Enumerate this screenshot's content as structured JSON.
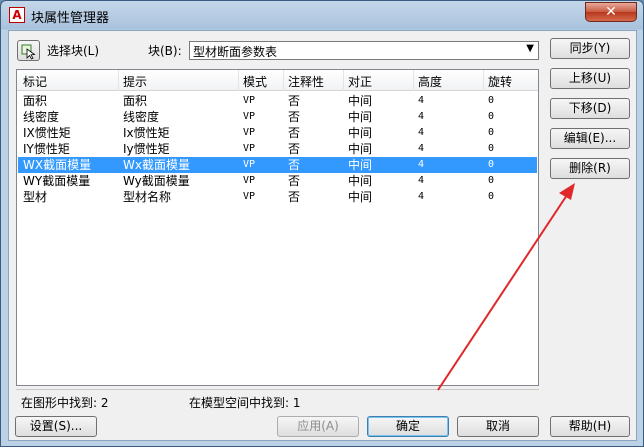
{
  "window": {
    "title": "块属性管理器",
    "app_icon": "A",
    "close_glyph": "✕"
  },
  "toolbar": {
    "select_block_label": "选择块(L)",
    "block_label": "块(B):",
    "block_value": "型材断面参数表",
    "block_arrow": "▼"
  },
  "table": {
    "columns": [
      "标记",
      "提示",
      "模式",
      "注释性",
      "对正",
      "高度",
      "旋转"
    ],
    "rows": [
      [
        "面积",
        "面积",
        "VP",
        "否",
        "中间",
        "4",
        "0"
      ],
      [
        "线密度",
        "线密度",
        "VP",
        "否",
        "中间",
        "4",
        "0"
      ],
      [
        "IX惯性矩",
        "Ix惯性矩",
        "VP",
        "否",
        "中间",
        "4",
        "0"
      ],
      [
        "IY惯性矩",
        "Iy惯性矩",
        "VP",
        "否",
        "中间",
        "4",
        "0"
      ],
      [
        "WX截面模量",
        "Wx截面模量",
        "VP",
        "否",
        "中间",
        "4",
        "0"
      ],
      [
        "WY截面模量",
        "Wy截面模量",
        "VP",
        "否",
        "中间",
        "4",
        "0"
      ],
      [
        "型材",
        "型材名称",
        "VP",
        "否",
        "中间",
        "4",
        "0"
      ]
    ],
    "selected_row": 4
  },
  "side_buttons": {
    "sync": "同步(Y)",
    "move_up": "上移(U)",
    "move_down": "下移(D)",
    "edit": "编辑(E)...",
    "delete": "删除(R)"
  },
  "status": {
    "found_in_drawing": "在图形中找到: 2",
    "found_in_model": "在模型空间中找到: 1"
  },
  "bottom_buttons": {
    "settings": "设置(S)...",
    "apply": "应用(A)",
    "ok": "确定",
    "cancel": "取消",
    "help": "帮助(H)"
  },
  "colors": {
    "selection": "#3399ff",
    "annotation_arrow": "#e0282a"
  }
}
